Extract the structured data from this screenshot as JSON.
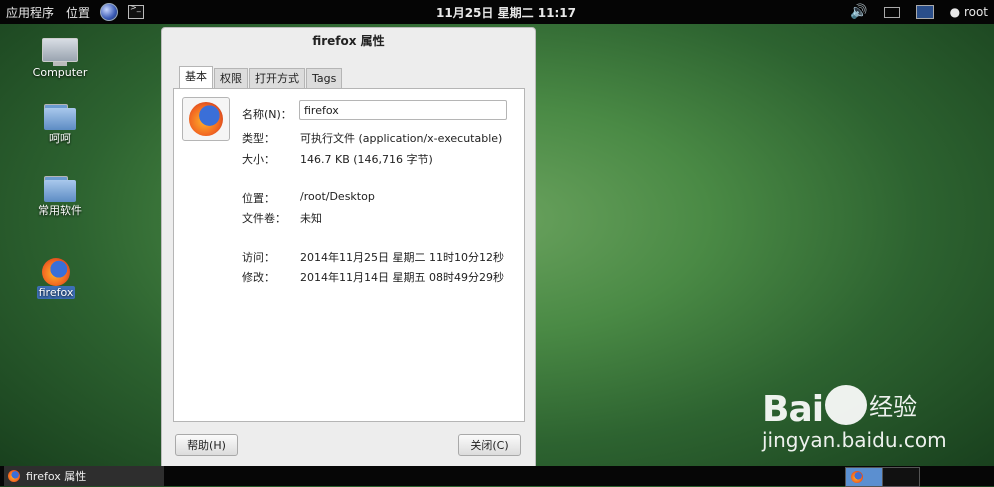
{
  "top_panel": {
    "applications": "应用程序",
    "places": "位置",
    "clock": "11月25日 星期二 11:17",
    "user": "root"
  },
  "desktop_icons": [
    {
      "label": "Computer",
      "icon": "computer-icon"
    },
    {
      "label": "呵呵",
      "icon": "folder-icon"
    },
    {
      "label": "常用软件",
      "icon": "folder-icon"
    },
    {
      "label": "firefox",
      "icon": "firefox-icon",
      "selected": true
    }
  ],
  "dialog": {
    "title": "firefox 属性",
    "tabs": [
      "基本",
      "权限",
      "打开方式",
      "Tags"
    ],
    "active_tab": 0,
    "fields": {
      "name_label": "名称(N)：",
      "name_value": "firefox",
      "type_label": "类型：",
      "type_value": "可执行文件 (application/x-executable)",
      "size_label": "大小：",
      "size_value": "146.7 KB (146,716 字节)",
      "location_label": "位置：",
      "location_value": "/root/Desktop",
      "volume_label": "文件卷：",
      "volume_value": "未知",
      "accessed_label": "访问：",
      "accessed_value": "2014年11月25日 星期二 11时10分12秒",
      "modified_label": "修改：",
      "modified_value": "2014年11月14日 星期五 08时49分29秒"
    },
    "help_button": "帮助(H)",
    "close_button": "关闭(C)"
  },
  "taskbar": {
    "window_title": "firefox 属性"
  },
  "watermark": {
    "brand_left": "Bai",
    "brand_right": "经验",
    "url": "jingyan.baidu.com"
  }
}
